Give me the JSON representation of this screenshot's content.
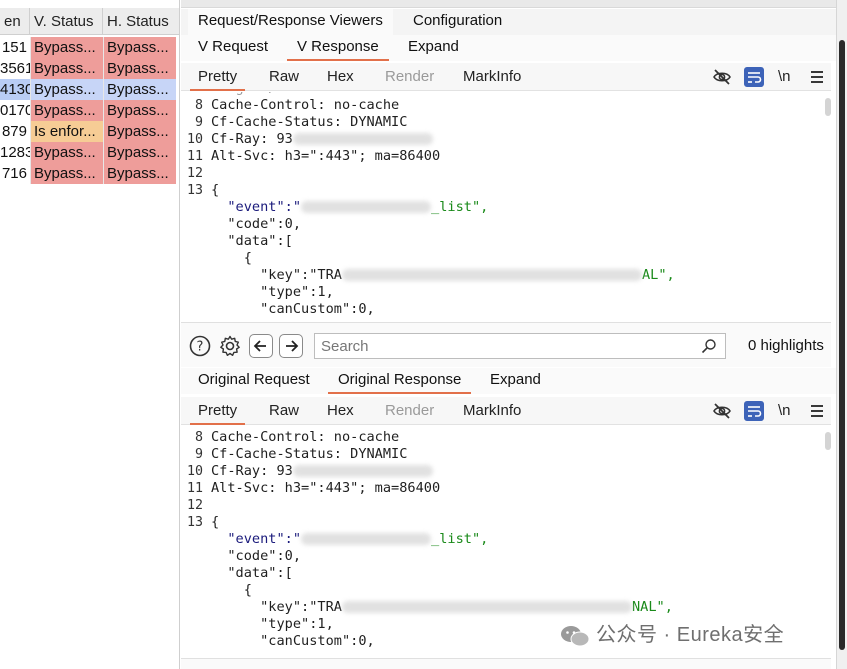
{
  "left_table": {
    "headers": [
      "en",
      "V. Status",
      "H. Status"
    ],
    "rows": [
      {
        "num": "151",
        "v": "Bypass...",
        "h": "Bypass...",
        "v_color": "red",
        "selected": false
      },
      {
        "num": "3561",
        "v": "Bypass...",
        "h": "Bypass...",
        "v_color": "red",
        "selected": false
      },
      {
        "num": "4130",
        "v": "Bypass...",
        "h": "Bypass...",
        "v_color": "red",
        "selected": true
      },
      {
        "num": "0170",
        "v": "Bypass...",
        "h": "Bypass...",
        "v_color": "red",
        "selected": false
      },
      {
        "num": "879",
        "v": "Is enfor...",
        "h": "Bypass...",
        "v_color": "orange",
        "selected": false
      },
      {
        "num": "1283",
        "v": "Bypass...",
        "h": "Bypass...",
        "v_color": "red",
        "selected": false
      },
      {
        "num": "716",
        "v": "Bypass...",
        "h": "Bypass...",
        "v_color": "red",
        "selected": false
      }
    ]
  },
  "top_tabs": [
    "Request/Response Viewers",
    "Configuration"
  ],
  "viewer_tabs_top": [
    "V Request",
    "V Response",
    "Expand"
  ],
  "viewer_tabs_bottom": [
    "Original Request",
    "Original Response",
    "Expand"
  ],
  "format_tabs": [
    "Pretty",
    "Raw",
    "Hex",
    "Render",
    "MarkInfo"
  ],
  "toolbar_icons": [
    "hide-eye-icon",
    "wrap-lines-icon",
    "newline-icon",
    "menu-icon"
  ],
  "newline_label": "\\n",
  "search": {
    "placeholder": "Search",
    "highlights": "0 highlights"
  },
  "code_lines": [
    {
      "n": "8",
      "text": "Cache-Control: no-cache"
    },
    {
      "n": "9",
      "text": "Cf-Cache-Status: DYNAMIC"
    },
    {
      "n": "10",
      "text": "Cf-Ray: 93"
    },
    {
      "n": "11",
      "text": "Alt-Svc: h3=\":443\"; ma=86400"
    },
    {
      "n": "12",
      "text": ""
    },
    {
      "n": "13",
      "text": "{"
    },
    {
      "n": "",
      "text": "  \"event\":\""
    },
    {
      "n": "",
      "text": "  \"code\":0,"
    },
    {
      "n": "",
      "text": "  \"data\":["
    },
    {
      "n": "",
      "text": "    {"
    },
    {
      "n": "",
      "text": "      \"key\":\"TRA"
    },
    {
      "n": "",
      "text": "      \"type\":1,"
    },
    {
      "n": "",
      "text": "      \"canCustom\":0,"
    }
  ],
  "code_lines_bottom_cfray": "Cf-Ray: 93",
  "event_suffix_top": "_list\",",
  "event_suffix_bottom": "_list\",",
  "key_suffix_top": "AL\",",
  "key_suffix_bottom": "NAL\",",
  "watermark": "公众号 · Eureka安全"
}
